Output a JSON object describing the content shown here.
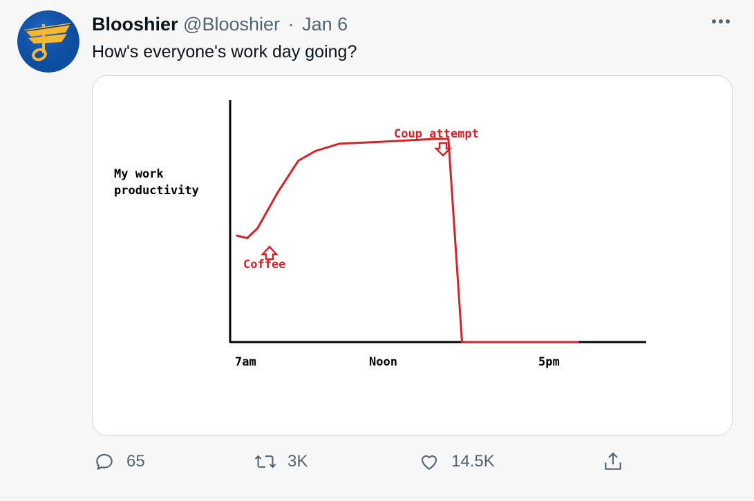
{
  "tweet": {
    "display_name": "Blooshier",
    "handle": "@Blooshier",
    "separator": "·",
    "date": "Jan 6",
    "text": "How's everyone's work day going?",
    "more_icon": "more-dots-icon"
  },
  "chart_data": {
    "type": "line",
    "ylabel": [
      "My work",
      "productivity"
    ],
    "x_tick_labels": [
      "7am",
      "Noon",
      "5pm"
    ],
    "annotations": [
      "Coffee",
      "Coup attempt"
    ],
    "series": [
      {
        "values": [
          [
            7.0,
            0.44
          ],
          [
            7.3,
            0.43
          ],
          [
            7.6,
            0.47
          ],
          [
            8.2,
            0.62
          ],
          [
            8.8,
            0.75
          ],
          [
            9.3,
            0.79
          ],
          [
            10.0,
            0.82
          ],
          [
            11.5,
            0.83
          ],
          [
            12.8,
            0.84
          ],
          [
            13.2,
            0.84
          ],
          [
            13.6,
            0.0
          ],
          [
            17.0,
            0.0
          ]
        ]
      }
    ],
    "xlim": [
      6.8,
      19.0
    ],
    "ylim": [
      0,
      1
    ],
    "colors": {
      "line": "#d92027",
      "annotation": "#d92027",
      "axis": "#000000",
      "text": "#000000"
    }
  },
  "actions": {
    "reply": {
      "icon": "reply-icon",
      "count": "65"
    },
    "retweet": {
      "icon": "retweet-icon",
      "count": "3K"
    },
    "like": {
      "icon": "heart-icon",
      "count": "14.5K"
    },
    "share": {
      "icon": "share-icon"
    }
  },
  "colors": {
    "muted": "#536471",
    "text": "#0f1419",
    "avatar_bg": "#0d4fa3",
    "avatar_gold": "#f5b82e"
  }
}
